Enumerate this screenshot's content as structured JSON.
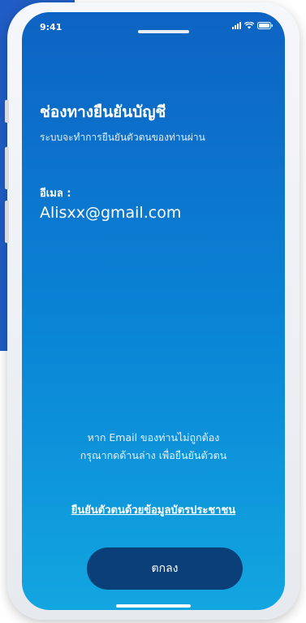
{
  "status_bar": {
    "time": "9:41"
  },
  "content": {
    "title": "ช่องทางยืนยันบัญชี",
    "subtitle": "ระบบจะทำการยืนยันตัวตนของท่านผ่าน",
    "email_label": "อีเมล :",
    "email_value": "Alisxx@gmail.com",
    "hint_line1": "หาก Email ของท่านไม่ถูกต้อง",
    "hint_line2": "กรุณากดด้านล่าง เพื่อยืนยันตัวตน",
    "verify_link": "ยืนยันตัวตนด้วยข้อมูลบัตรประชาชน"
  },
  "actions": {
    "ok_label": "ตกลง"
  },
  "icons": [
    "signal-icon",
    "wifi-icon",
    "battery-icon"
  ],
  "colors": {
    "screen_top": "#0d63c3",
    "screen_bottom": "#12a6e0",
    "button": "#0b3f78",
    "backdrop": "#1f5cc4"
  }
}
